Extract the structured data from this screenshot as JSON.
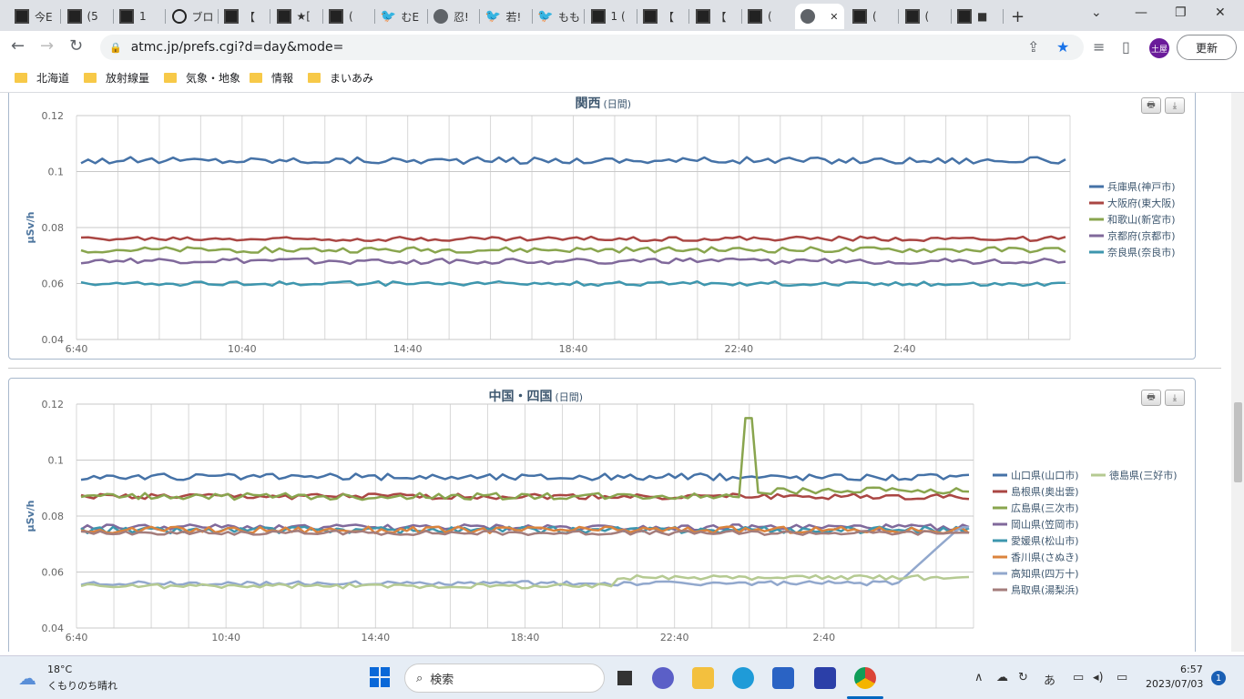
{
  "tabs": [
    {
      "label": "今E",
      "icon": "dark-favicon"
    },
    {
      "label": "(5",
      "icon": "dark-favicon"
    },
    {
      "label": "1 ",
      "icon": "dark-favicon"
    },
    {
      "label": "ブロ",
      "icon": "ring-favicon"
    },
    {
      "label": "【",
      "icon": "dark-favicon"
    },
    {
      "label": "★[",
      "icon": "dark-favicon"
    },
    {
      "label": "(",
      "icon": "dark-favicon"
    },
    {
      "label": "むE",
      "icon": "twitter-icon"
    },
    {
      "label": "忍!",
      "icon": "globe-icon"
    },
    {
      "label": "若!",
      "icon": "twitter-icon"
    },
    {
      "label": "もも",
      "icon": "twitter-icon"
    },
    {
      "label": "1 (",
      "icon": "dark-favicon"
    },
    {
      "label": "【",
      "icon": "dark-favicon"
    },
    {
      "label": "【",
      "icon": "dark-favicon"
    },
    {
      "label": "(",
      "icon": "dark-favicon"
    },
    {
      "label": "",
      "icon": "globe-icon",
      "active": true
    },
    {
      "label": "(",
      "icon": "dark-favicon"
    },
    {
      "label": "(",
      "icon": "dark-favicon"
    },
    {
      "label": "■",
      "icon": "dark-favicon"
    }
  ],
  "address": "atmc.jp/prefs.cgi?d=day&mode=",
  "update_label": "更新",
  "avatar_label": "土屋",
  "bookmarks": [
    "北海道",
    "放射線量",
    "気象・地象",
    "情報",
    "まいあみ"
  ],
  "chart_data": [
    {
      "type": "line",
      "title": "関西",
      "subtitle": "(日間)",
      "ylabel": "µSv/h",
      "ylim": [
        0.04,
        0.12
      ],
      "yticks": [
        "0.12",
        "0.1",
        "0.08",
        "0.06",
        "0.04"
      ],
      "xticks": [
        "6:40",
        "10:40",
        "14:40",
        "18:40",
        "22:40",
        "2:40"
      ],
      "legend_position": "right",
      "series": [
        {
          "name": "兵庫県(神戸市)",
          "color": "#4572a7",
          "base": 0.104,
          "noise": 0.0012
        },
        {
          "name": "大阪府(東大阪)",
          "color": "#aa4643",
          "base": 0.076,
          "noise": 0.0008
        },
        {
          "name": "和歌山(新宮市)",
          "color": "#89a54e",
          "base": 0.072,
          "noise": 0.001
        },
        {
          "name": "京都府(京都市)",
          "color": "#80699b",
          "base": 0.068,
          "noise": 0.001
        },
        {
          "name": "奈良県(奈良市)",
          "color": "#3d96ae",
          "base": 0.06,
          "noise": 0.0008
        }
      ]
    },
    {
      "type": "line",
      "title": "中国・四国",
      "subtitle": "(日間)",
      "ylabel": "µSv/h",
      "ylim": [
        0.04,
        0.12
      ],
      "yticks": [
        "0.12",
        "0.1",
        "0.08",
        "0.06",
        "0.04"
      ],
      "xticks": [
        "6:40",
        "10:40",
        "14:40",
        "18:40",
        "22:40",
        "2:40"
      ],
      "legend_position": "right",
      "series": [
        {
          "name": "山口県(山口市)",
          "color": "#4572a7",
          "base": 0.094,
          "noise": 0.0012
        },
        {
          "name": "島根県(奥出雲)",
          "color": "#aa4643",
          "base": 0.087,
          "noise": 0.001
        },
        {
          "name": "広島県(三次市)",
          "color": "#89a54e",
          "base": 0.087,
          "noise": 0.0012,
          "spike": 0.115
        },
        {
          "name": "岡山県(笠岡市)",
          "color": "#80699b",
          "base": 0.076,
          "noise": 0.001
        },
        {
          "name": "愛媛県(松山市)",
          "color": "#3d96ae",
          "base": 0.075,
          "noise": 0.0012
        },
        {
          "name": "香川県(さぬき)",
          "color": "#db843d",
          "base": 0.075,
          "noise": 0.0012
        },
        {
          "name": "高知県(四万十)",
          "color": "#92a8cd",
          "base": 0.056,
          "noise": 0.0008,
          "rise": 0.076
        },
        {
          "name": "鳥取県(湯梨浜)",
          "color": "#a47d7c",
          "base": 0.074,
          "noise": 0.0008
        },
        {
          "name": "徳島県(三好市)",
          "color": "#b5ca92",
          "base": 0.055,
          "noise": 0.0008,
          "late": 0.058
        }
      ]
    }
  ],
  "taskbar": {
    "temp": "18°C",
    "weather": "くもりのち晴れ",
    "search": "検索",
    "time": "6:57",
    "date": "2023/07/03",
    "notif": "1",
    "ime": "あ"
  }
}
